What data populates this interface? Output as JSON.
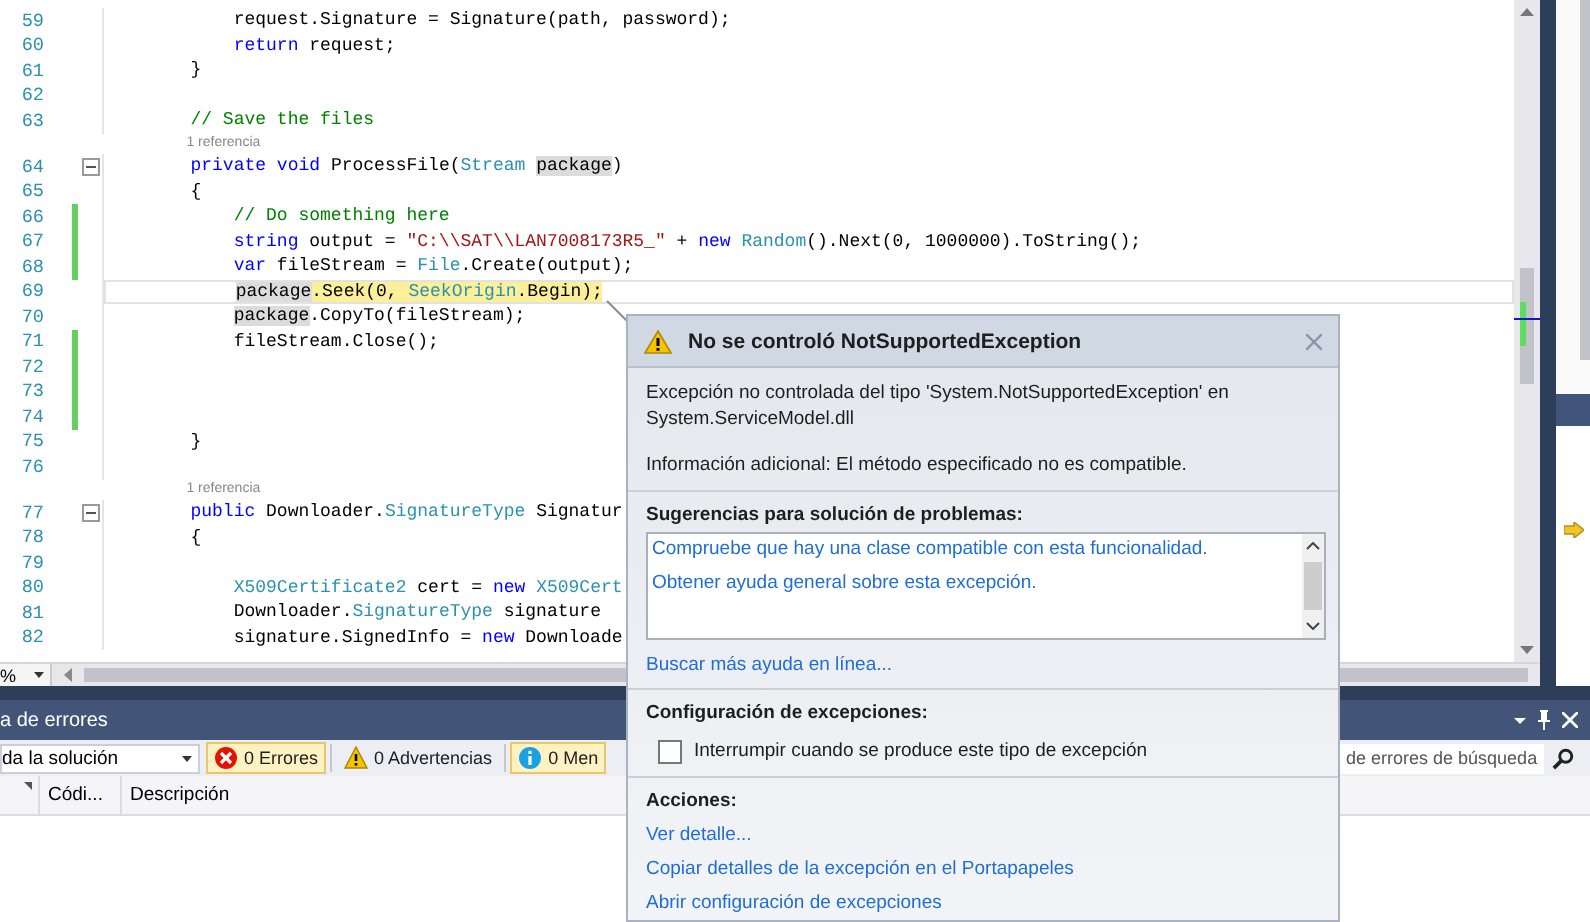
{
  "editor": {
    "zoom": "%",
    "lines": [
      {
        "kind": "code",
        "number": "59",
        "changed": false,
        "fold": false,
        "current": false,
        "segments": [
          {
            "kind": "plain",
            "text": "            request.Signature = Signature(path, password);"
          }
        ]
      },
      {
        "kind": "code",
        "number": "60",
        "changed": false,
        "fold": false,
        "current": false,
        "segments": [
          {
            "kind": "keyword",
            "text": "            return"
          },
          {
            "kind": "plain",
            "text": " request;"
          }
        ]
      },
      {
        "kind": "code",
        "number": "61",
        "changed": false,
        "fold": false,
        "current": false,
        "segments": [
          {
            "kind": "plain",
            "text": "        }"
          }
        ]
      },
      {
        "kind": "code",
        "number": "62",
        "changed": false,
        "fold": false,
        "current": false
      },
      {
        "kind": "code",
        "number": "63",
        "changed": false,
        "fold": false,
        "current": false,
        "segments": [
          {
            "kind": "comment",
            "text": "        // Save the files"
          }
        ]
      },
      {
        "kind": "codelens",
        "text": "1 referencia"
      },
      {
        "kind": "code",
        "number": "64",
        "changed": false,
        "fold": true,
        "current": false,
        "segments": [
          {
            "kind": "keyword",
            "text": "        private void"
          },
          {
            "kind": "plain",
            "text": " ProcessFile("
          },
          {
            "kind": "type",
            "text": "Stream "
          },
          {
            "kind": "reference",
            "text": "package"
          },
          {
            "kind": "plain",
            "text": ")"
          }
        ]
      },
      {
        "kind": "code",
        "number": "65",
        "changed": false,
        "fold": false,
        "current": false,
        "segments": [
          {
            "kind": "plain",
            "text": "        {"
          }
        ]
      },
      {
        "kind": "code",
        "number": "66",
        "changed": true,
        "fold": false,
        "current": false,
        "segments": [
          {
            "kind": "comment",
            "text": "            // Do something here"
          }
        ]
      },
      {
        "kind": "code",
        "number": "67",
        "changed": true,
        "fold": false,
        "current": false,
        "segments": [
          {
            "kind": "keyword",
            "text": "            string"
          },
          {
            "kind": "plain",
            "text": " output = "
          },
          {
            "kind": "string",
            "text": "\"C:\\\\SAT\\\\LAN7008173R5_\""
          },
          {
            "kind": "plain",
            "text": " + "
          },
          {
            "kind": "keyword",
            "text": "new "
          },
          {
            "kind": "type",
            "text": "Random"
          },
          {
            "kind": "plain",
            "text": "().Next(0, 1000000).ToString();"
          }
        ]
      },
      {
        "kind": "code",
        "number": "68",
        "changed": true,
        "fold": false,
        "current": false,
        "segments": [
          {
            "kind": "keyword",
            "text": "            var"
          },
          {
            "kind": "plain",
            "text": " fileStream = "
          },
          {
            "kind": "type",
            "text": "File"
          },
          {
            "kind": "plain",
            "text": ".Create(output);"
          }
        ]
      },
      {
        "kind": "code",
        "number": "69",
        "changed": false,
        "fold": false,
        "current": true,
        "segments": [
          {
            "kind": "reference",
            "text": "            package"
          },
          {
            "kind": "statement",
            "text": ".Seek(0, "
          },
          {
            "kind": "statement-type",
            "text": "SeekOrigin"
          },
          {
            "kind": "statement",
            "text": ".Begin);"
          }
        ]
      },
      {
        "kind": "code",
        "number": "70",
        "changed": false,
        "fold": false,
        "current": false,
        "segments": [
          {
            "kind": "reference",
            "text": "            package"
          },
          {
            "kind": "plain",
            "text": ".CopyTo(fileStream);"
          }
        ]
      },
      {
        "kind": "code",
        "number": "71",
        "changed": true,
        "fold": false,
        "current": false,
        "segments": [
          {
            "kind": "plain",
            "text": "            fileStream.Close();"
          }
        ]
      },
      {
        "kind": "code",
        "number": "72",
        "changed": true,
        "fold": false,
        "current": false
      },
      {
        "kind": "code",
        "number": "73",
        "changed": true,
        "fold": false,
        "current": false
      },
      {
        "kind": "code",
        "number": "74",
        "changed": true,
        "fold": false,
        "current": false
      },
      {
        "kind": "code",
        "number": "75",
        "changed": false,
        "fold": false,
        "current": false,
        "segments": [
          {
            "kind": "plain",
            "text": "        }"
          }
        ]
      },
      {
        "kind": "code",
        "number": "76",
        "changed": false,
        "fold": false,
        "current": false
      },
      {
        "kind": "codelens",
        "text": "1 referencia"
      },
      {
        "kind": "code",
        "number": "77",
        "changed": false,
        "fold": true,
        "current": false,
        "segments": [
          {
            "kind": "keyword",
            "text": "        public"
          },
          {
            "kind": "plain",
            "text": " Downloader."
          },
          {
            "kind": "type",
            "text": "SignatureType"
          },
          {
            "kind": "plain",
            "text": " Signatur"
          }
        ]
      },
      {
        "kind": "code",
        "number": "78",
        "changed": false,
        "fold": false,
        "current": false,
        "segments": [
          {
            "kind": "plain",
            "text": "        {"
          }
        ]
      },
      {
        "kind": "code",
        "number": "79",
        "changed": false,
        "fold": false,
        "current": false
      },
      {
        "kind": "code",
        "number": "80",
        "changed": false,
        "fold": false,
        "current": false,
        "segments": [
          {
            "kind": "type",
            "text": "            X509Certificate2"
          },
          {
            "kind": "plain",
            "text": " cert = "
          },
          {
            "kind": "keyword",
            "text": "new "
          },
          {
            "kind": "type",
            "text": "X509Cert"
          }
        ]
      },
      {
        "kind": "code",
        "number": "81",
        "changed": false,
        "fold": false,
        "current": false,
        "segments": [
          {
            "kind": "plain",
            "text": "            Downloader."
          },
          {
            "kind": "type",
            "text": "SignatureType"
          },
          {
            "kind": "plain",
            "text": " signature"
          }
        ]
      },
      {
        "kind": "code",
        "number": "82",
        "changed": false,
        "fold": false,
        "current": false,
        "segments": [
          {
            "kind": "plain",
            "text": "            signature.SignedInfo = "
          },
          {
            "kind": "keyword",
            "text": "new"
          },
          {
            "kind": "plain",
            "text": " Downloade"
          }
        ]
      }
    ]
  },
  "exception_popup": {
    "title": "No se controló NotSupportedException",
    "description": "Excepción no controlada del tipo 'System.NotSupportedException' en System.ServiceModel.dll",
    "info": "Información adicional: El método especificado no es compatible.",
    "suggestions_heading": "Sugerencias para solución de problemas:",
    "suggestions": [
      "Compruebe que hay una clase compatible con esta funcionalidad.",
      "Obtener ayuda general sobre esta excepción."
    ],
    "help_link": "Buscar más ayuda en línea...",
    "settings_heading": "Configuración de excepciones:",
    "break_option": {
      "label": "Interrumpir cuando se produce este tipo de excepción",
      "checked": false
    },
    "actions_heading": "Acciones:",
    "actions": [
      "Ver detalle...",
      "Copiar detalles de la excepción en el Portapapeles",
      "Abrir configuración de excepciones"
    ]
  },
  "error_list": {
    "title": "a de errores",
    "scope": "da la solución",
    "filters": [
      {
        "kind": "error",
        "label": "0 Errores",
        "selected": true
      },
      {
        "kind": "warning",
        "label": "0 Advertencias",
        "selected": false
      },
      {
        "kind": "info",
        "label": "0 Men",
        "selected": true
      }
    ],
    "search": {
      "placeholder": "de errores de búsqueda"
    },
    "columns": [
      "Códi...",
      "Descripción"
    ]
  }
}
